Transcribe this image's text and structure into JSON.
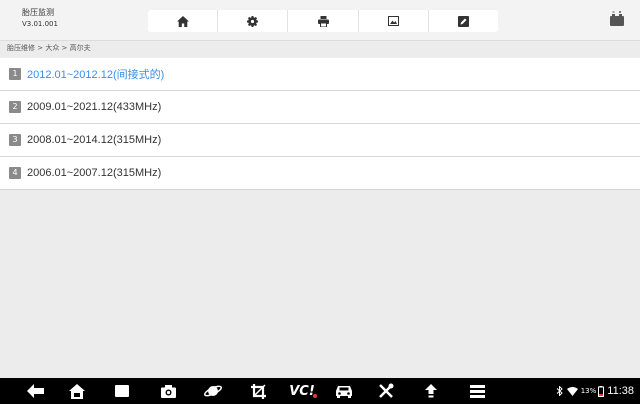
{
  "header": {
    "title": "胎压监测",
    "version": "V3.01.001",
    "toolbar": [
      {
        "icon": "home-icon"
      },
      {
        "icon": "settings-icon"
      },
      {
        "icon": "print-icon"
      },
      {
        "icon": "screenshot-icon"
      },
      {
        "icon": "edit-icon"
      }
    ],
    "battery_icon": "vehicle-battery-icon"
  },
  "breadcrumb": "胎压维修 > 大众 > 高尔夫",
  "list": {
    "items": [
      {
        "index": "1",
        "label": "2012.01~2012.12(间接式的)",
        "selected": true
      },
      {
        "index": "2",
        "label": "2009.01~2021.12(433MHz)",
        "selected": false
      },
      {
        "index": "3",
        "label": "2008.01~2014.12(315MHz)",
        "selected": false
      },
      {
        "index": "4",
        "label": "2006.01~2007.12(315MHz)",
        "selected": false
      }
    ]
  },
  "navbar": {
    "icons": [
      "back-icon",
      "home-icon",
      "recent-apps-icon",
      "camera-icon",
      "browser-icon",
      "crop-icon",
      "vci-icon",
      "car-icon",
      "tools-icon",
      "upload-icon",
      "menu-icon"
    ],
    "vci_label": "VC!",
    "status": {
      "battery_percent": "13%",
      "time": "11:38"
    }
  },
  "colors": {
    "accent": "#3a8ee6",
    "header_bg": "#f3f3f3",
    "page_bg": "#ececec",
    "navbar_bg": "#000000"
  }
}
